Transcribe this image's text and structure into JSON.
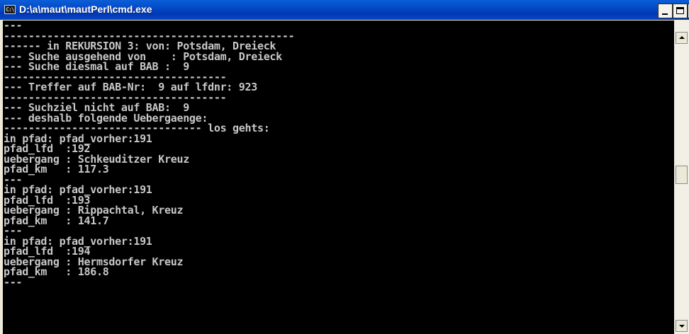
{
  "window": {
    "title": "D:\\a\\maut\\mautPerl\\cmd.exe",
    "icon": "cmd-icon",
    "icon_text": "C:\\",
    "buttons": [
      "minimize-icon",
      "maximize-icon",
      "close-icon"
    ]
  },
  "console": {
    "lines": [
      "---",
      "-----------------------------------------------",
      "------ in REKURSION 3: von: Potsdam, Dreieck",
      "--- Suche ausgehend von    : Potsdam, Dreieck",
      "--- Suche diesmal auf BAB :  9",
      "------------------------------------",
      "--- Treffer auf BAB-Nr:  9 auf lfdnr: 923",
      "------------------------------------",
      "--- Suchziel nicht auf BAB:  9",
      "--- deshalb folgende Uebergaenge:",
      "-------------------------------- los gehts:",
      "in pfad: pfad_vorher:191",
      "pfad_lfd  :192",
      "uebergang : Schkeuditzer Kreuz",
      "pfad_km   : 117.3",
      "---",
      "in pfad: pfad_vorher:191",
      "pfad_lfd  :193",
      "uebergang : Rippachtal, Kreuz",
      "pfad_km   : 141.7",
      "---",
      "in pfad: pfad_vorher:191",
      "pfad_lfd  :194",
      "uebergang : Hermsdorfer Kreuz",
      "pfad_km   : 186.8",
      "---"
    ]
  },
  "colors": {
    "titlebar": "#0447c4",
    "console_bg": "#000000",
    "console_fg": "#c8c8c8"
  }
}
